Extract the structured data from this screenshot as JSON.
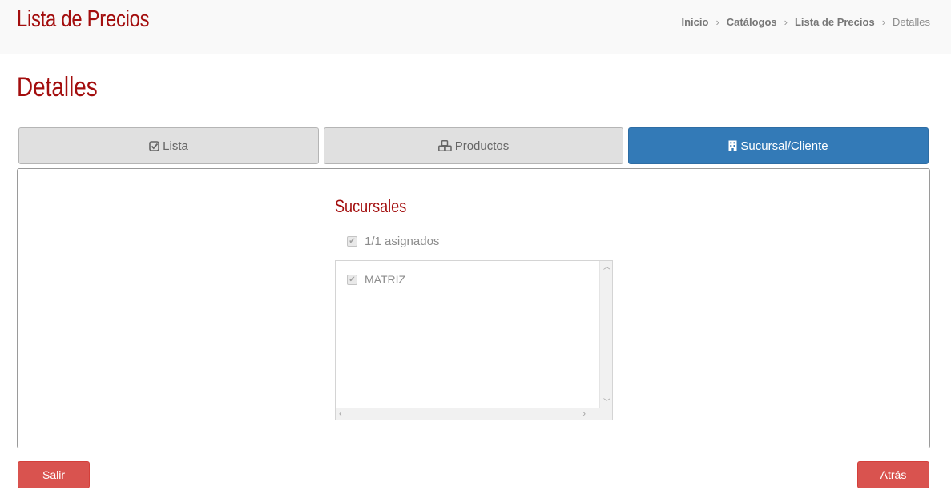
{
  "header": {
    "title": "Lista de Precios",
    "breadcrumb": [
      "Inicio",
      "Catálogos",
      "Lista de Precios",
      "Detalles"
    ]
  },
  "page": {
    "title": "Detalles"
  },
  "tabs": [
    {
      "label": "Lista",
      "icon": "check-square-icon"
    },
    {
      "label": "Productos",
      "icon": "cubes-icon"
    },
    {
      "label": "Sucursal/Cliente",
      "icon": "building-icon"
    }
  ],
  "sucursales": {
    "title": "Sucursales",
    "select_all_label": "1/1 asignados",
    "items": [
      {
        "label": "MATRIZ",
        "checked": true
      }
    ]
  },
  "buttons": {
    "exit": "Salir",
    "back": "Atrás"
  },
  "colors": {
    "brand": "#a30e0e",
    "active_tab": "#337ab7",
    "danger": "#d9534f"
  }
}
